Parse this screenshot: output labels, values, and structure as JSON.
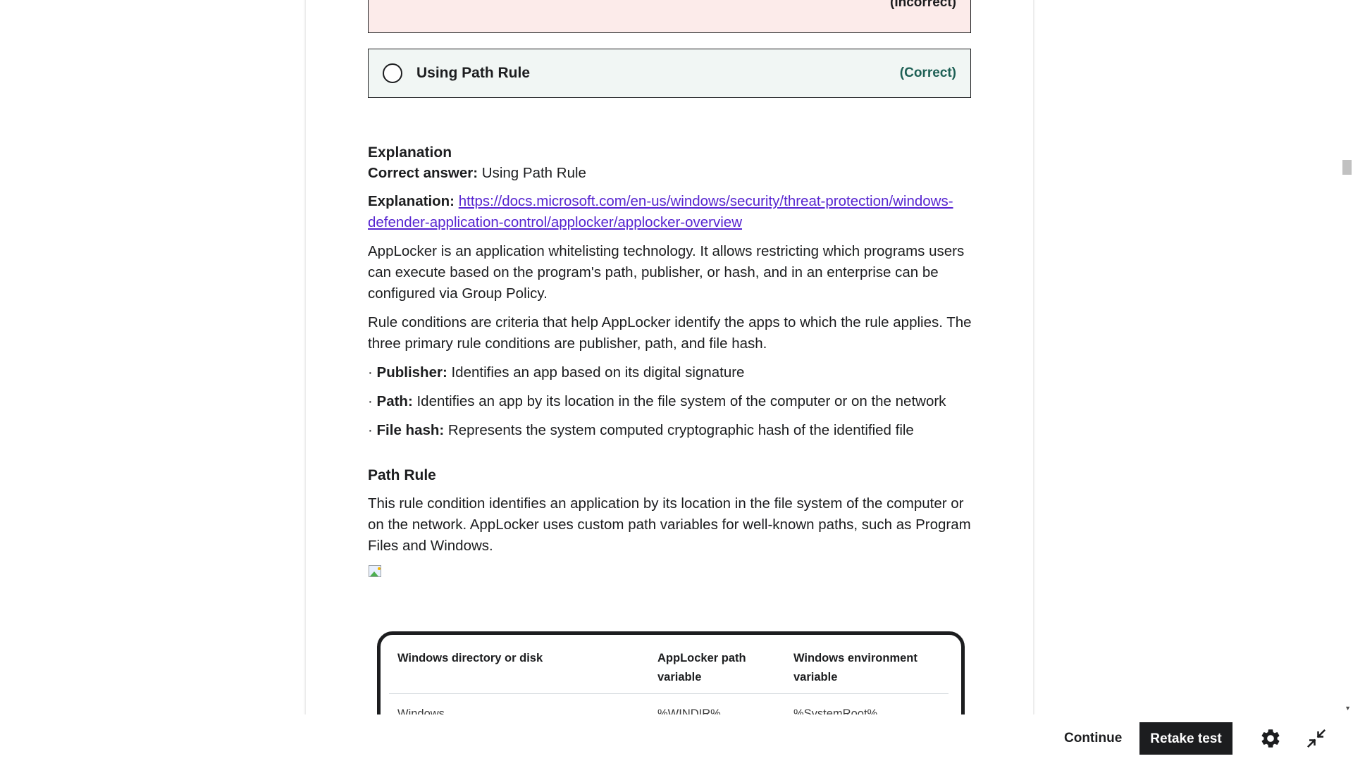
{
  "answers": {
    "incorrect": {
      "status": "(Incorrect)"
    },
    "correct": {
      "label": "Using Path Rule",
      "status": "(Correct)"
    }
  },
  "explanation": {
    "heading": "Explanation",
    "correct_answer_label": "Correct answer:",
    "correct_answer_value": "Using Path Rule",
    "explanation_label": "Explanation:",
    "link_text": "https://docs.microsoft.com/en-us/windows/security/threat-protection/windows-defender-application-control/applocker/applocker-overview",
    "paragraph_1": "AppLocker is an application whitelisting technology. It allows restricting which programs users can execute based on the program's path, publisher, or hash, and in an enterprise can be configured via Group Policy.",
    "paragraph_2": "Rule conditions are criteria that help AppLocker identify the apps to which the rule applies. The three primary rule conditions are publisher, path, and file hash.",
    "bullets": [
      {
        "label": "Publisher:",
        "text": "Identifies an app based on its digital signature"
      },
      {
        "label": "Path:",
        "text": "Identifies an app by its location in the file system of the computer or on the network"
      },
      {
        "label": "File hash:",
        "text": "Represents the system computed cryptographic hash of the identified file"
      }
    ],
    "path_rule_heading": "Path Rule",
    "path_rule_text": "This rule condition identifies an application by its location in the file system of the computer or on the network. AppLocker uses custom path variables for well-known paths, such as Program Files and Windows."
  },
  "path_table": {
    "headers": [
      "Windows directory or disk",
      "AppLocker path variable",
      "Windows environment variable"
    ],
    "rows": [
      [
        "Windows",
        "%WINDIR%",
        "%SystemRoot%"
      ]
    ]
  },
  "bottom_bar": {
    "continue_label": "Continue",
    "retake_label": "Retake test"
  },
  "icons": {
    "settings": "gear-icon",
    "collapse": "collapse-icon",
    "broken_image": "broken-image-icon"
  },
  "colors": {
    "incorrect_bg": "#fcebea",
    "correct_bg": "#f1f6f4",
    "correct_text": "#1e6055",
    "link": "#5624d0",
    "primary_button": "#1c1d1f"
  }
}
